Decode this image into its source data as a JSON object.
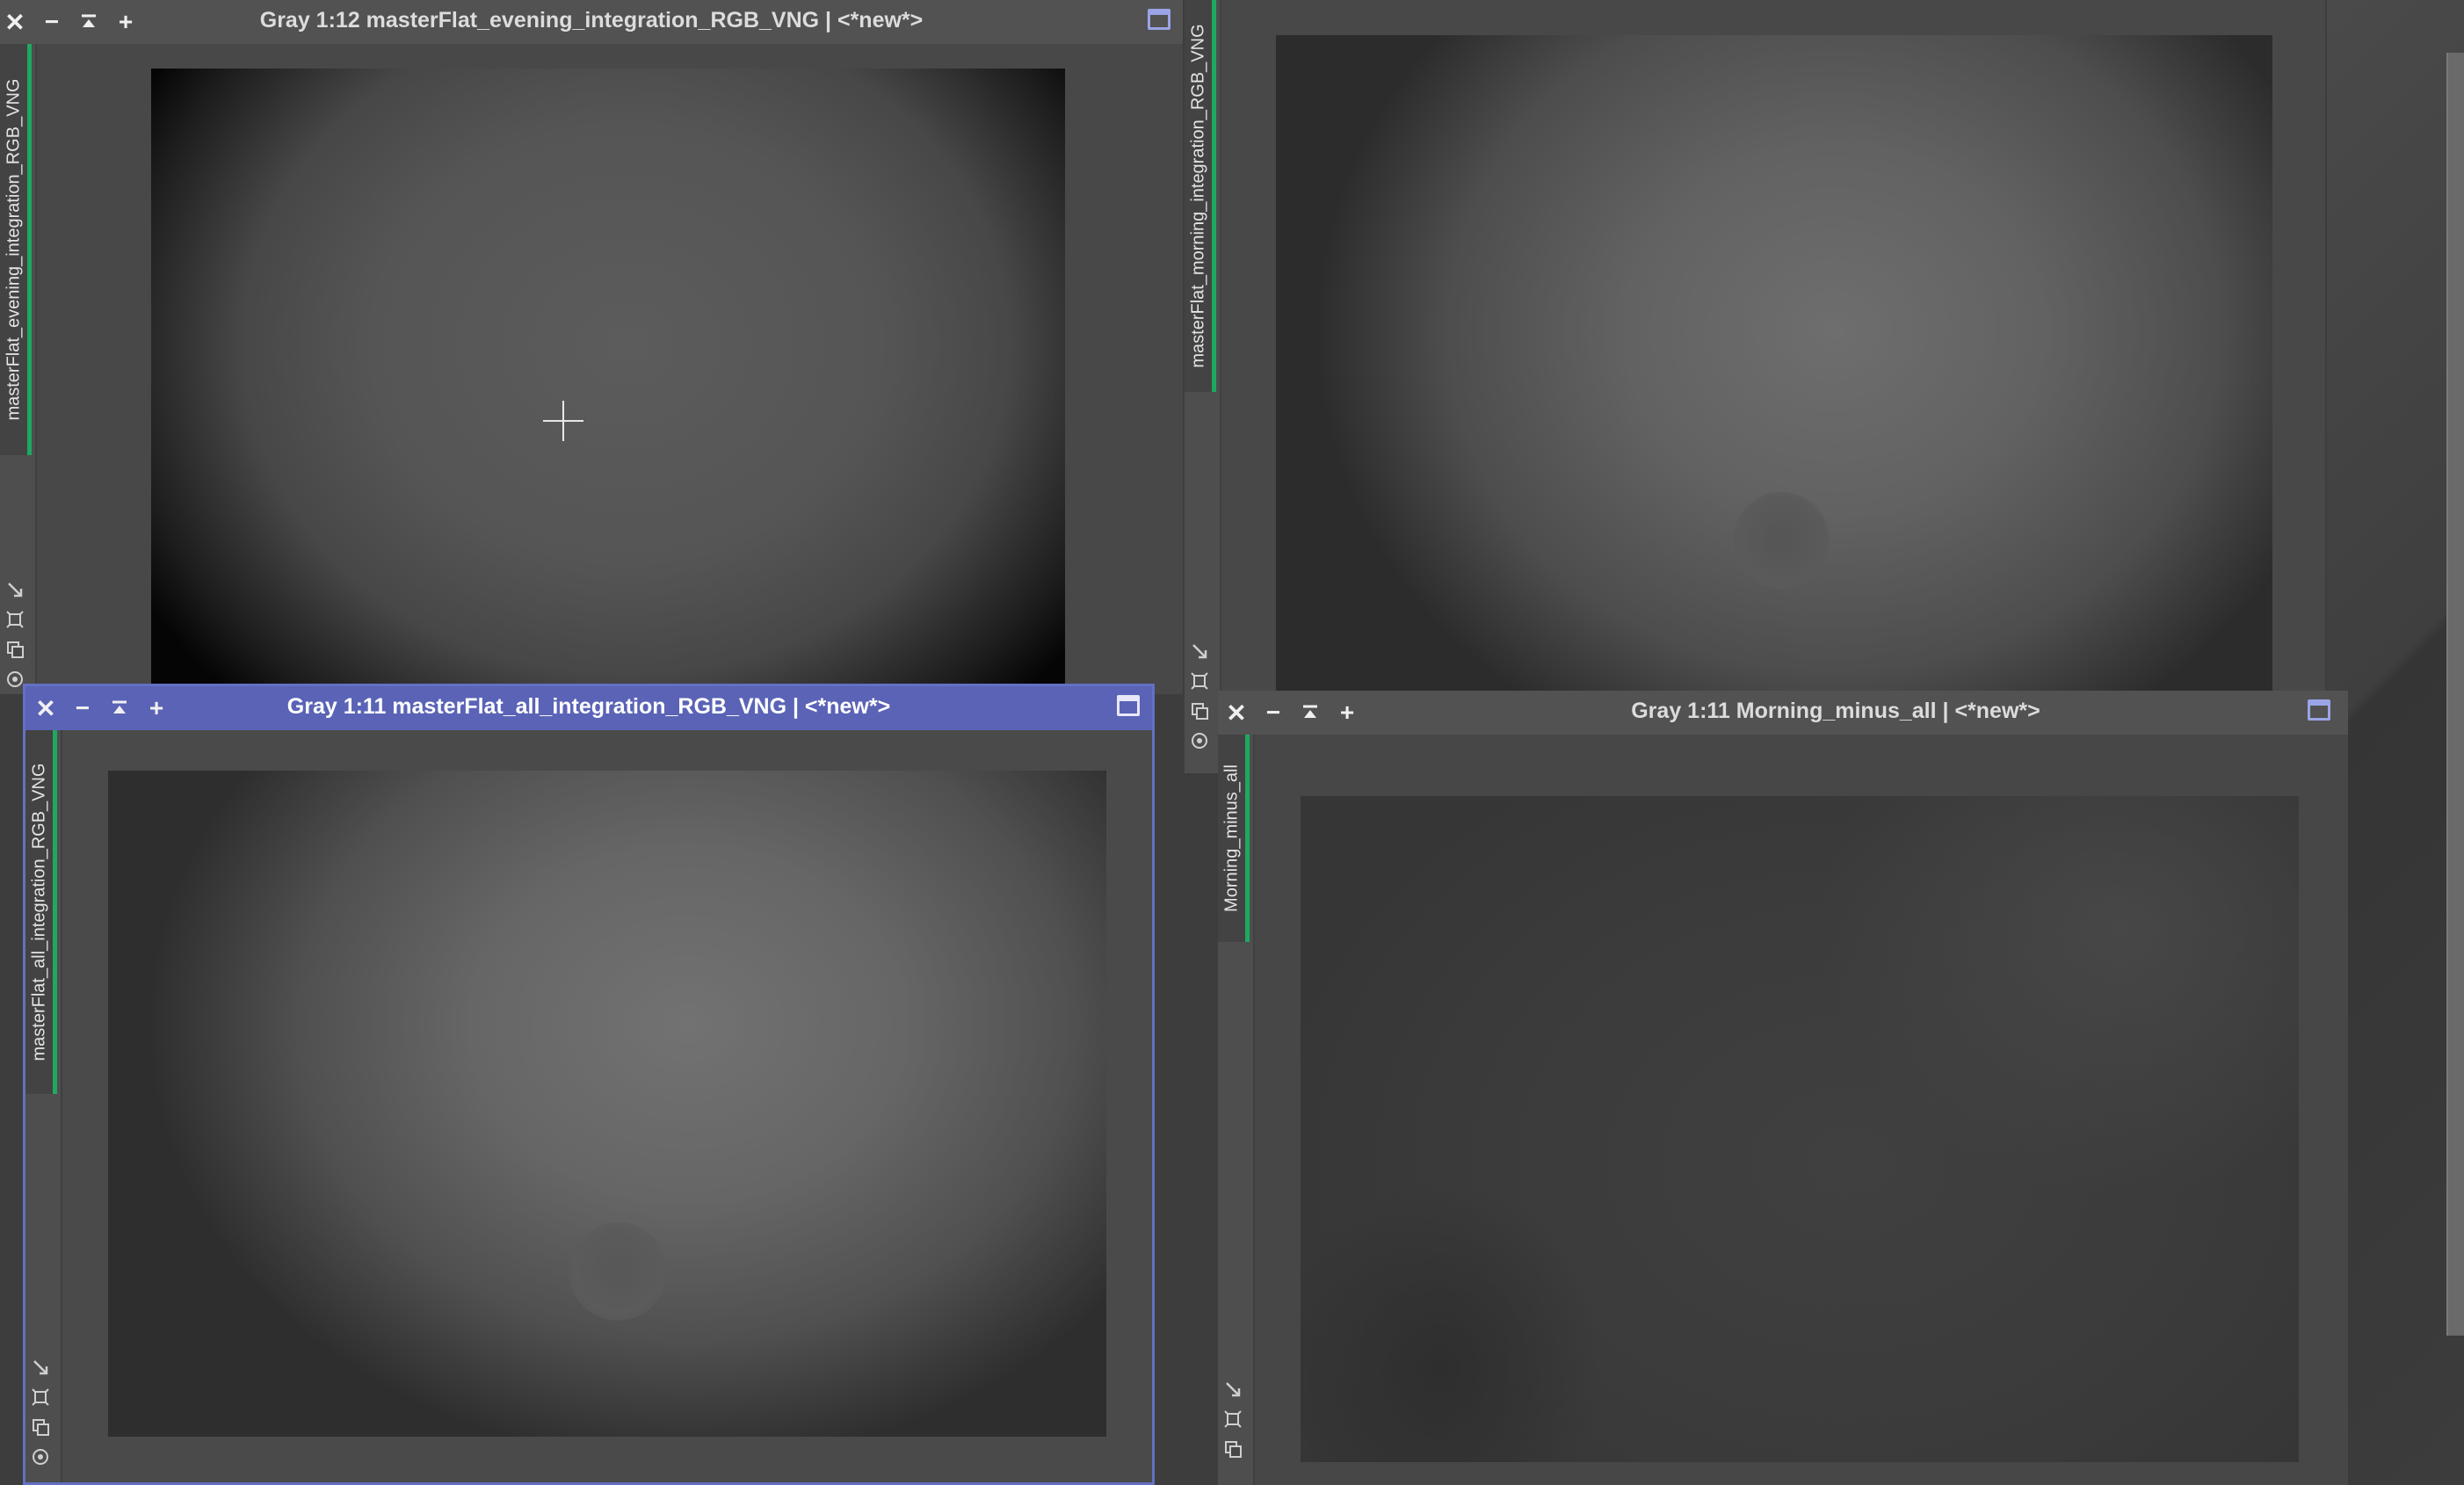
{
  "windows": [
    {
      "title": "Gray 1:12 masterFlat_evening_integration_RGB_VNG | <*new*>",
      "tab_label": "masterFlat_evening_integration_RGB_VNG",
      "active": false
    },
    {
      "title": "",
      "tab_label": "masterFlat_morning_integration_RGB_VNG",
      "active": false
    },
    {
      "title": "Gray 1:11 masterFlat_all_integration_RGB_VNG | <*new*>",
      "tab_label": "masterFlat_all_integration_RGB_VNG",
      "active": true
    },
    {
      "title": "Gray 1:11 Morning_minus_all | <*new*>",
      "tab_label": "Morning_minus_all",
      "active": false
    }
  ],
  "titlebar_buttons": [
    "close-icon",
    "minimize-icon",
    "shade-icon",
    "zoom-in-icon",
    "maximize-icon"
  ],
  "sidebar_icons": [
    "fit-view-icon",
    "zoom-region-icon",
    "clone-icon",
    "target-icon"
  ],
  "colors": {
    "active_titlebar": "#5a63b6",
    "inactive_titlebar": "#525252",
    "tab_accent": "#1fa860",
    "workspace": "#3d3d3d"
  }
}
